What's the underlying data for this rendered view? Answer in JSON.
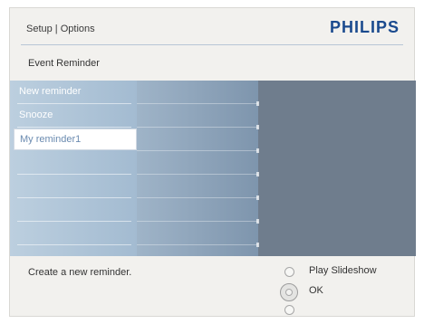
{
  "header": {
    "breadcrumb": "Setup | Options",
    "brand": "PHILIPS"
  },
  "page_title": "Event Reminder",
  "menu": {
    "items": [
      {
        "label": "New reminder",
        "selected": false
      },
      {
        "label": "Snooze",
        "selected": false
      },
      {
        "label": "My reminder1",
        "selected": true
      }
    ]
  },
  "footer": {
    "help_text": "Create a new reminder."
  },
  "controls": {
    "play_slideshow_label": "Play Slideshow",
    "ok_label": "OK"
  },
  "colors": {
    "brand": "#1a4a8e",
    "selected_text": "#6b8bb0",
    "panel_dark": "#6f7d8d"
  }
}
